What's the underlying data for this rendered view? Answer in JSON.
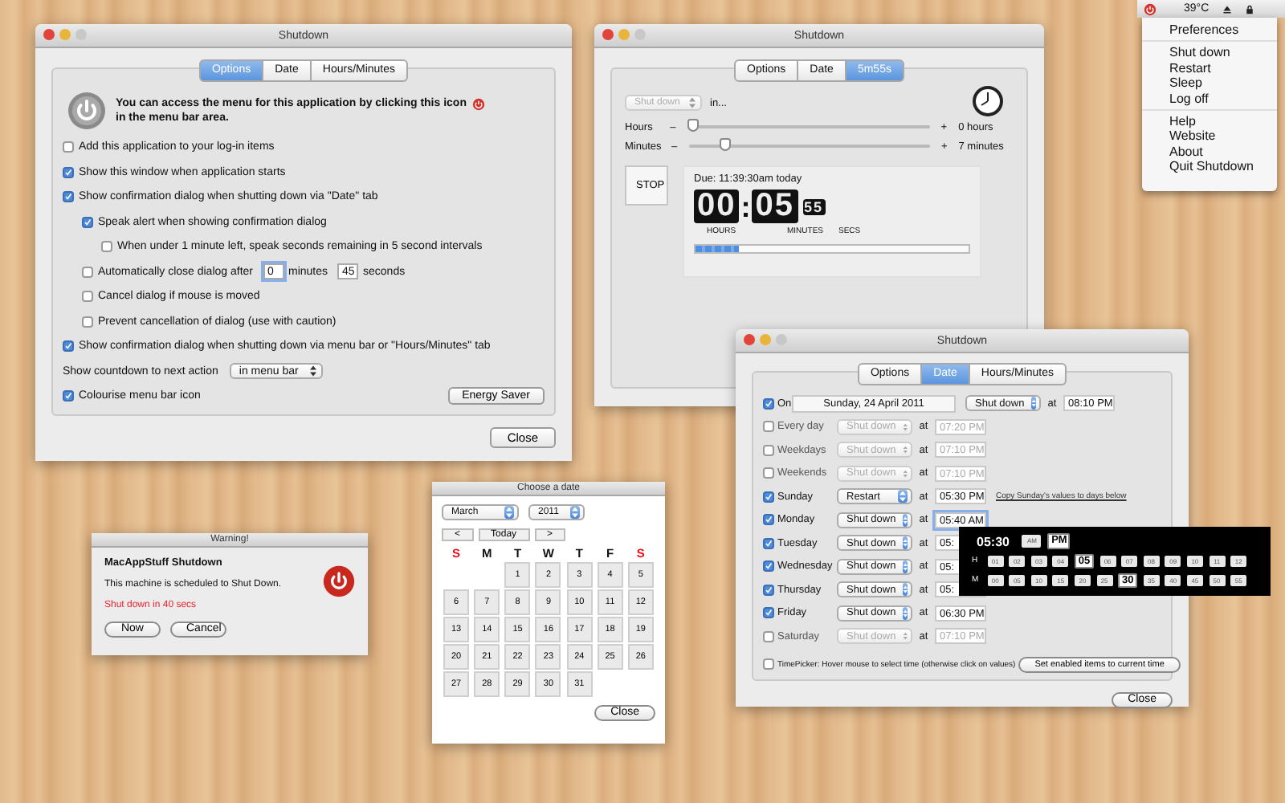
{
  "menubar": {
    "temperature": "39°C"
  },
  "status_menu": {
    "items": [
      {
        "kind": "item",
        "label": "Preferences"
      },
      {
        "kind": "separator"
      },
      {
        "kind": "item",
        "label": "Shut down"
      },
      {
        "kind": "item",
        "label": "Restart"
      },
      {
        "kind": "item",
        "label": "Sleep"
      },
      {
        "kind": "item",
        "label": "Log off"
      },
      {
        "kind": "separator"
      },
      {
        "kind": "item",
        "label": "Help"
      },
      {
        "kind": "item",
        "label": "Website"
      },
      {
        "kind": "item",
        "label": "About"
      },
      {
        "kind": "item",
        "label": "Quit Shutdown"
      }
    ]
  },
  "options_window": {
    "title": "Shutdown",
    "tabs": [
      {
        "label": "Options",
        "selected": true
      },
      {
        "label": "Date",
        "selected": false
      },
      {
        "label": "Hours/Minutes",
        "selected": false
      }
    ],
    "info_lines": [
      "You can access the menu for this application by clicking this icon",
      "in the menu bar area."
    ],
    "options": [
      {
        "kind": "check",
        "label": "Add this application to your log-in items",
        "checked": false
      },
      {
        "kind": "check",
        "label": "Show this window when application starts",
        "checked": true
      },
      {
        "kind": "check",
        "label": "Show confirmation dialog when shutting down via \"Date\" tab",
        "checked": true,
        "children": [
          {
            "kind": "check",
            "label": "Speak alert when showing confirmation dialog",
            "checked": true,
            "children": [
              {
                "kind": "check",
                "label": "When under 1 minute left, speak seconds remaining in 5 second intervals",
                "checked": false
              }
            ]
          },
          {
            "kind": "timeout",
            "label": "Automatically close dialog after",
            "checked": false,
            "minutes": "0",
            "minutes_label": "minutes",
            "seconds": "45",
            "seconds_label": "seconds"
          },
          {
            "kind": "check",
            "label": "Cancel dialog if mouse is moved",
            "checked": false
          },
          {
            "kind": "check",
            "label": "Prevent cancellation of dialog (use with caution)",
            "checked": false
          }
        ]
      },
      {
        "kind": "check",
        "label": "Show confirmation dialog when shutting down via menu bar or \"Hours/Minutes\" tab",
        "checked": true
      }
    ],
    "countdown": {
      "label": "Show countdown to next action",
      "value": "in menu bar"
    },
    "colourise": {
      "label": "Colourise menu bar icon",
      "checked": true
    },
    "energy_button": "Energy Saver",
    "close_button": "Close"
  },
  "timer_window": {
    "title": "Shutdown",
    "tabs": [
      {
        "label": "Options",
        "selected": false
      },
      {
        "label": "Date",
        "selected": false
      },
      {
        "label": "5m55s",
        "selected": true
      }
    ],
    "action": {
      "value": "Shut down",
      "disabled": true
    },
    "in_label": "in...",
    "sliders": [
      {
        "label": "Hours",
        "minus": "–",
        "plus": "+",
        "level": 0.0,
        "reading": "0 hours"
      },
      {
        "label": "Minutes",
        "minus": "–",
        "plus": "+",
        "level": 0.13,
        "reading": "7 minutes"
      }
    ],
    "stop_button": "STOP",
    "due": "Due:  11:39:30am today",
    "hours": "00",
    "separator": ":",
    "minutes": "05",
    "secs": "55",
    "hours_label": "HOURS",
    "minutes_label": "MINUTES",
    "secs_label": "SECS",
    "progress": {
      "level": 0.16
    }
  },
  "date_window": {
    "title": "Shutdown",
    "tabs": [
      {
        "label": "Options",
        "selected": false
      },
      {
        "label": "Date",
        "selected": true
      },
      {
        "label": "Hours/Minutes",
        "selected": false
      }
    ],
    "on_row": {
      "label": "On",
      "checked": true,
      "date": "Sunday, 24 April 2011",
      "action": "Shut down",
      "at": "at",
      "time": "08:10 PM"
    },
    "rows": [
      {
        "label": "Every day",
        "checked": false,
        "action": "Shut down",
        "at": "at",
        "time": "07:20 PM"
      },
      {
        "label": "Weekdays",
        "checked": false,
        "action": "Shut down",
        "at": "at",
        "time": "07:10 PM"
      },
      {
        "label": "Weekends",
        "checked": false,
        "action": "Shut down",
        "at": "at",
        "time": "07:10 PM"
      },
      {
        "label": "Sunday",
        "checked": true,
        "action": "Restart",
        "at": "at",
        "time": "05:30 PM",
        "link": "Copy Sunday's values to days below"
      },
      {
        "label": "Monday",
        "checked": true,
        "action": "Shut down",
        "at": "at",
        "time": "05:40 AM",
        "focused": true
      },
      {
        "label": "Tuesday",
        "checked": true,
        "action": "Shut down",
        "at": "at",
        "time": "05:"
      },
      {
        "label": "Wednesday",
        "checked": true,
        "action": "Shut down",
        "at": "at",
        "time": "05:"
      },
      {
        "label": "Thursday",
        "checked": true,
        "action": "Shut down",
        "at": "at",
        "time": "05:"
      },
      {
        "label": "Friday",
        "checked": true,
        "action": "Shut down",
        "at": "at",
        "time": "06:30 PM"
      },
      {
        "label": "Saturday",
        "checked": false,
        "action": "Shut down",
        "at": "at",
        "time": "07:10 PM"
      }
    ],
    "timepicker": {
      "label": "TimePicker: Hover mouse to select time (otherwise click on values)",
      "checked": false
    },
    "set_button": "Set enabled items to current time",
    "close_button": "Close"
  },
  "time_picker": {
    "time": "05:30",
    "ampm": [
      {
        "label": "AM",
        "selected": false
      },
      {
        "label": "PM",
        "selected": true
      }
    ],
    "hours_label": "H",
    "hours": [
      {
        "label": "01",
        "selected": false
      },
      {
        "label": "02",
        "selected": false
      },
      {
        "label": "03",
        "selected": false
      },
      {
        "label": "04",
        "selected": false
      },
      {
        "label": "05",
        "selected": true
      },
      {
        "label": "06",
        "selected": false
      },
      {
        "label": "07",
        "selected": false
      },
      {
        "label": "08",
        "selected": false
      },
      {
        "label": "09",
        "selected": false
      },
      {
        "label": "10",
        "selected": false
      },
      {
        "label": "11",
        "selected": false
      },
      {
        "label": "12",
        "selected": false
      }
    ],
    "minutes_label": "M",
    "minutes": [
      {
        "label": "00",
        "selected": false
      },
      {
        "label": "05",
        "selected": false
      },
      {
        "label": "10",
        "selected": false
      },
      {
        "label": "15",
        "selected": false
      },
      {
        "label": "20",
        "selected": false
      },
      {
        "label": "25",
        "selected": false
      },
      {
        "label": "30",
        "selected": true
      },
      {
        "label": "35",
        "selected": false
      },
      {
        "label": "40",
        "selected": false
      },
      {
        "label": "45",
        "selected": false
      },
      {
        "label": "50",
        "selected": false
      },
      {
        "label": "55",
        "selected": false
      }
    ]
  },
  "warning": {
    "title": "Warning!",
    "app": "MacAppStuff Shutdown",
    "message": "This machine is scheduled to Shut Down.",
    "countdown": "Shut down in 40 secs",
    "buttons": [
      "Now",
      "Cancel"
    ]
  },
  "calendar": {
    "title": "Choose a date",
    "month": "March",
    "year": "2011",
    "nav": [
      "<",
      "Today",
      ">"
    ],
    "weekdays": [
      {
        "label": "S",
        "color": "#e8101a"
      },
      {
        "label": "M",
        "color": "#111111"
      },
      {
        "label": "T",
        "color": "#111111"
      },
      {
        "label": "W",
        "color": "#111111"
      },
      {
        "label": "T",
        "color": "#111111"
      },
      {
        "label": "F",
        "color": "#111111"
      },
      {
        "label": "S",
        "color": "#e8101a"
      }
    ],
    "cells": [
      {
        "kind": "blank"
      },
      {
        "kind": "blank"
      },
      {
        "kind": "day",
        "label": "1"
      },
      {
        "kind": "day",
        "label": "2"
      },
      {
        "kind": "day",
        "label": "3"
      },
      {
        "kind": "day",
        "label": "4"
      },
      {
        "kind": "day",
        "label": "5"
      },
      {
        "kind": "day",
        "label": "6"
      },
      {
        "kind": "day",
        "label": "7"
      },
      {
        "kind": "day",
        "label": "8"
      },
      {
        "kind": "day",
        "label": "9"
      },
      {
        "kind": "day",
        "label": "10"
      },
      {
        "kind": "day",
        "label": "11"
      },
      {
        "kind": "day",
        "label": "12"
      },
      {
        "kind": "day",
        "label": "13"
      },
      {
        "kind": "day",
        "label": "14"
      },
      {
        "kind": "day",
        "label": "15"
      },
      {
        "kind": "day",
        "label": "16"
      },
      {
        "kind": "day",
        "label": "17"
      },
      {
        "kind": "day",
        "label": "18"
      },
      {
        "kind": "day",
        "label": "19"
      },
      {
        "kind": "day",
        "label": "20"
      },
      {
        "kind": "day",
        "label": "21"
      },
      {
        "kind": "day",
        "label": "22"
      },
      {
        "kind": "day",
        "label": "23"
      },
      {
        "kind": "day",
        "label": "24"
      },
      {
        "kind": "day",
        "label": "25"
      },
      {
        "kind": "day",
        "label": "26"
      },
      {
        "kind": "day",
        "label": "27"
      },
      {
        "kind": "day",
        "label": "28"
      },
      {
        "kind": "day",
        "label": "29"
      },
      {
        "kind": "day",
        "label": "30"
      },
      {
        "kind": "day",
        "label": "31"
      }
    ],
    "close_button": "Close"
  }
}
